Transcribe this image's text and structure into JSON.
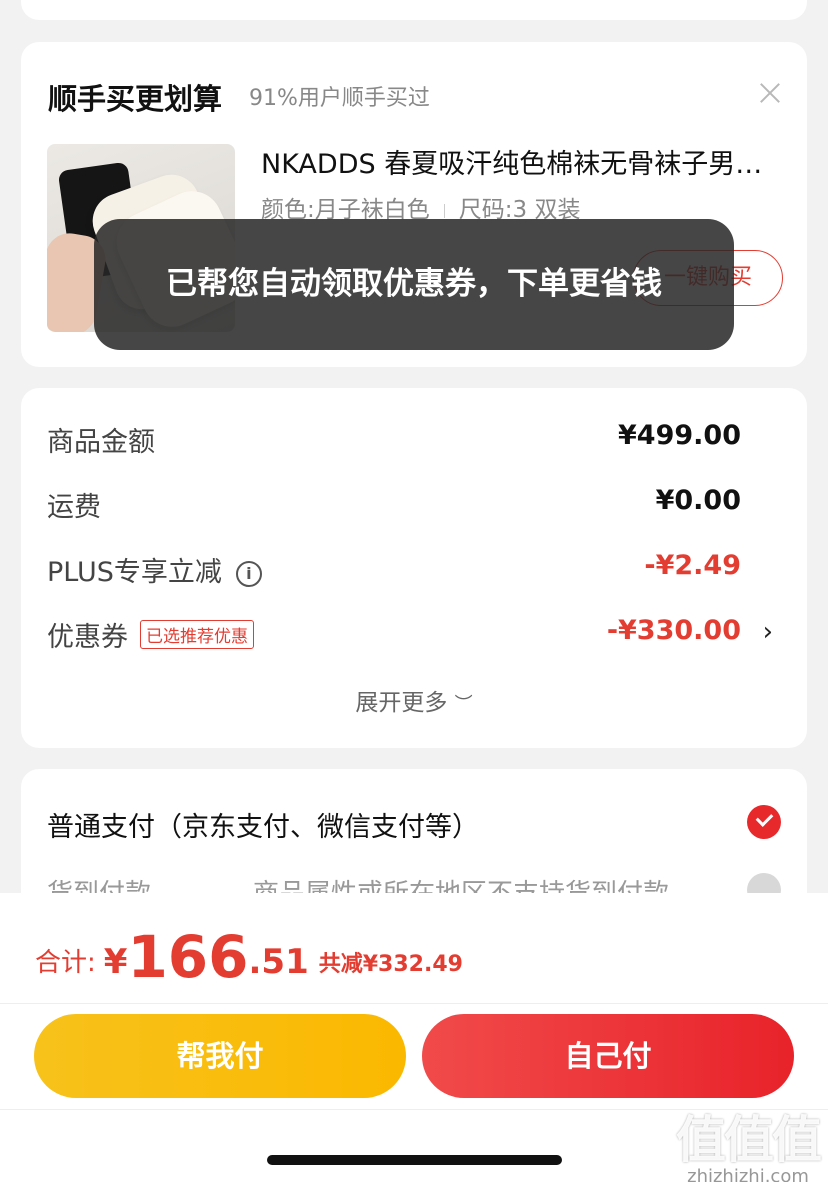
{
  "suggest": {
    "title": "顺手买更划算",
    "subtitle": "91%用户顺手买过",
    "product_name": "NKADDS 春夏吸汗纯色棉袜无骨袜子男女中筒袜",
    "spec_color": "颜色:月子袜白色",
    "spec_size": "尺码:3 双装",
    "buy_button": "一键购买"
  },
  "toast": "已帮您自动领取优惠券，下单更省钱",
  "price_detail": {
    "rows": [
      {
        "label": "商品金额",
        "value": "¥499.00"
      },
      {
        "label": "运费",
        "value": "¥0.00"
      },
      {
        "label": "PLUS专享立减",
        "value": "-¥2.49"
      },
      {
        "label": "优惠券",
        "badge": "已选推荐优惠",
        "value": "-¥330.00"
      }
    ],
    "expand": "展开更多"
  },
  "payment": {
    "option1": "普通支付（京东支付、微信支付等）",
    "option2": "货到付款",
    "option2_note": "商品属性或所在地区不支持货到付款"
  },
  "bottom": {
    "total_label": "合计:",
    "yen": "¥",
    "total_int": "166",
    "total_dec": ".51",
    "total_save": "共减¥332.49",
    "help_pay": "帮我付",
    "self_pay": "自己付"
  },
  "watermark": {
    "glyphs": "值值值",
    "text": "zhizhizhi.com"
  },
  "colors": {
    "accent_red": "#e33d32",
    "help_yellow": "#f7c21b"
  }
}
